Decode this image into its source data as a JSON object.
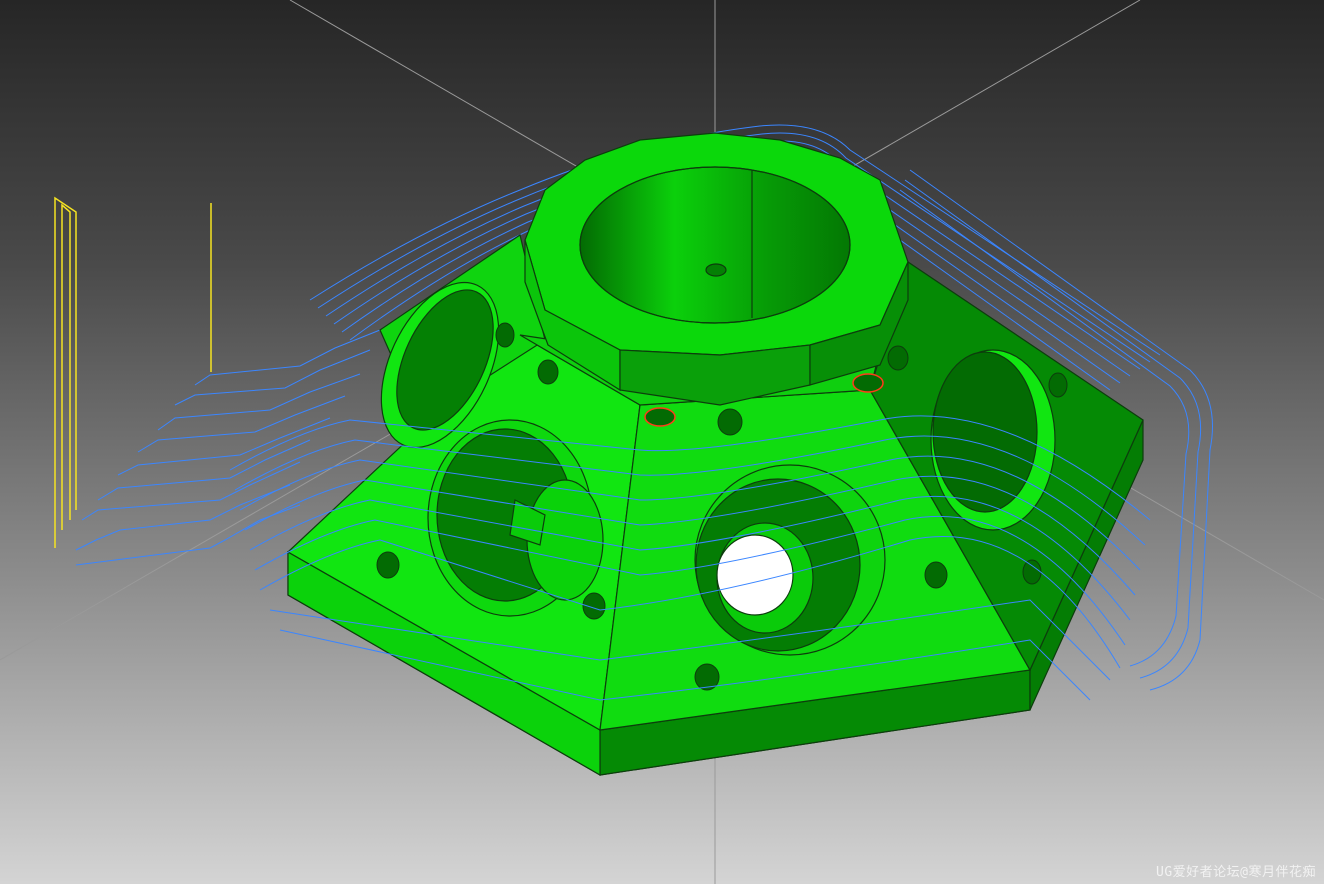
{
  "viewport": {
    "background_top": "#262626",
    "background_bottom": "#d4d4d4"
  },
  "colors": {
    "part_face_light": "#11e611",
    "part_face_mid": "#0abf0a",
    "part_face_dark": "#058a05",
    "edge": "#0d3d0d",
    "toolpath": "#3b86ff",
    "tool_axis": "#f5e322",
    "hole_highlight": "#ff3b1a",
    "datum_axes": "#9a9a9a"
  },
  "watermark": {
    "text": "UG爱好者论坛@寒月伴花痴"
  }
}
